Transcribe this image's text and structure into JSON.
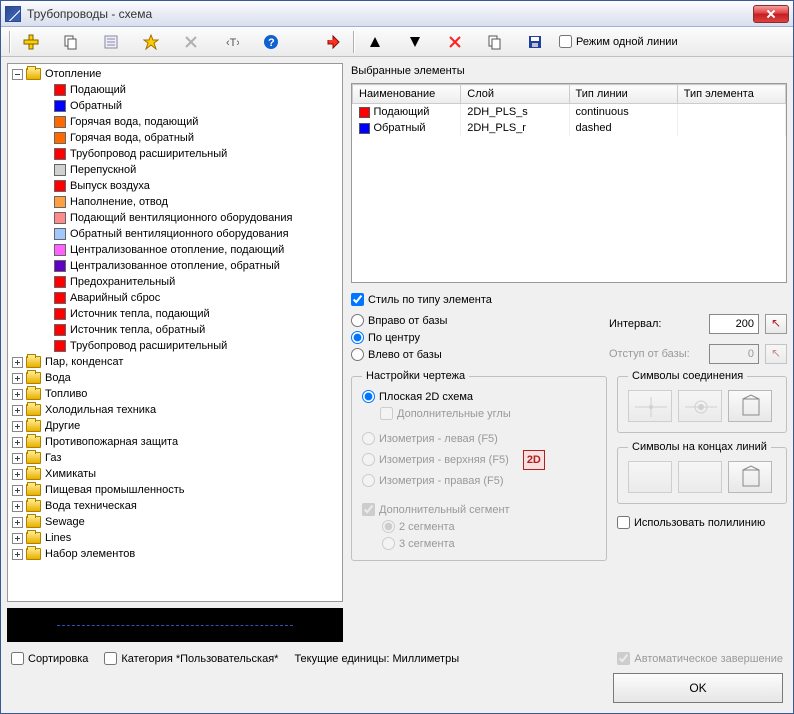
{
  "window": {
    "title": "Трубопроводы - схема"
  },
  "toolbar": {
    "single_line_mode": "Режим одной линии",
    "single_line_checked": false
  },
  "tree": {
    "root": {
      "label": "Отопление",
      "expanded": true
    },
    "root_children": [
      {
        "color": "#ff0000",
        "label": "Подающий"
      },
      {
        "color": "#0000ff",
        "label": "Обратный"
      },
      {
        "color": "#ff6a00",
        "label": "Горячая вода, подающий"
      },
      {
        "color": "#ff6a00",
        "label": "Горячая вода, обратный"
      },
      {
        "color": "#ff0000",
        "label": "Трубопровод расширительный"
      },
      {
        "color": "#d0d0d0",
        "label": "Перепускной"
      },
      {
        "color": "#ff0000",
        "label": "Выпуск воздуха"
      },
      {
        "color": "#ffa040",
        "label": "Наполнение, отвод"
      },
      {
        "color": "#ff8a8a",
        "label": "Подающий вентиляционного оборудования"
      },
      {
        "color": "#a0c8ff",
        "label": "Обратный вентиляционного оборудования"
      },
      {
        "color": "#ff60ff",
        "label": "Централизованное отопление, подающий"
      },
      {
        "color": "#6000c0",
        "label": "Централизованное отопление, обратный"
      },
      {
        "color": "#ff0000",
        "label": "Предохранительный"
      },
      {
        "color": "#ff0000",
        "label": "Аварийный сброс"
      },
      {
        "color": "#ff0000",
        "label": "Источник тепла, подающий"
      },
      {
        "color": "#ff0000",
        "label": "Источник тепла, обратный"
      },
      {
        "color": "#ff0000",
        "label": "Трубопровод расширительный"
      }
    ],
    "siblings": [
      "Пар, конденсат",
      "Вода",
      "Топливо",
      "Холодильная техника",
      "Другие",
      "Противопожарная защита",
      "Газ",
      "Химикаты",
      "Пищевая промышленность",
      "Вода техническая",
      "Sewage",
      "Lines",
      "Набор элементов"
    ]
  },
  "selected": {
    "heading": "Выбранные элементы",
    "columns": [
      "Наименование",
      "Слой",
      "Тип линии",
      "Тип элемента"
    ],
    "rows": [
      {
        "color": "#ff0000",
        "name": "Подающий",
        "layer": "2DH_PLS_s",
        "ltype": "continuous",
        "etype": ""
      },
      {
        "color": "#0000ff",
        "name": "Обратный",
        "layer": "2DH_PLS_r",
        "ltype": "dashed",
        "etype": ""
      }
    ]
  },
  "style_by_element": {
    "label": "Стиль по типу элемента",
    "checked": true
  },
  "offset": {
    "right": "Вправо от базы",
    "center": "По центру",
    "left": "Влево от базы",
    "selected": "center",
    "interval_label": "Интервал:",
    "interval_value": "200",
    "base_offset_label": "Отступ от базы:",
    "base_offset_value": "0"
  },
  "drawing": {
    "heading": "Настройки чертежа",
    "flat2d": "Плоская 2D схема",
    "add_angles": "Дополнительные углы",
    "iso_left": "Изометрия - левая (F5)",
    "iso_top": "Изометрия - верхняя (F5)",
    "iso_right": "Изометрия - правая (F5)",
    "view_badge": "2D",
    "add_segment": "Дополнительный сегмент",
    "seg2": "2 сегмента",
    "seg3": "3 сегмента"
  },
  "symbols_join": {
    "heading": "Символы соединения"
  },
  "symbols_ends": {
    "heading": "Символы на концах линий"
  },
  "use_polyline": {
    "label": "Использовать полилинию",
    "checked": false
  },
  "bottom": {
    "sort": "Сортировка",
    "category": "Категория *Пользовательская*",
    "units": "Текущие единицы: Миллиметры",
    "auto_close": "Автоматическое завершение",
    "ok": "OK"
  }
}
